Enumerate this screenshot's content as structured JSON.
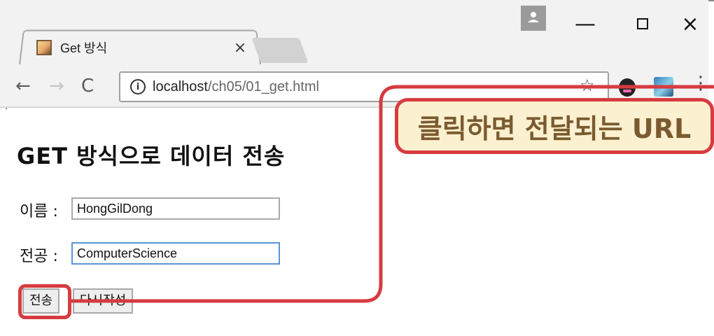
{
  "browser": {
    "tab": {
      "title": "Get 방식",
      "close_glyph": "×",
      "favicon": "page-favicon-icon"
    },
    "window_controls": {
      "user_icon": "user-icon",
      "minimize_glyph": "—",
      "close_glyph": "×"
    },
    "toolbar": {
      "back_glyph": "←",
      "forward_glyph": "→",
      "reload_glyph": "C",
      "info_glyph": "i",
      "url_host": "localhost",
      "url_path": "/ch05/01_get.html",
      "star_glyph": "☆",
      "menu_glyph": "⋮"
    }
  },
  "page": {
    "heading": "GET 방식으로 데이터 전송",
    "form": {
      "name_label": "이름 :",
      "name_value": "HongGilDong",
      "major_label": "전공 :",
      "major_value": "ComputerScience",
      "submit_label": "전송",
      "reset_label": "다시작성"
    }
  },
  "annotation": {
    "callout_text": "클릭하면 전달되는 URL",
    "accent_color": "#d63b3f",
    "callout_bg": "#fbf0cf"
  }
}
